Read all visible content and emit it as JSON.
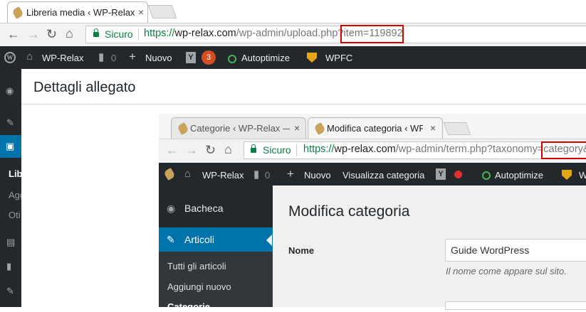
{
  "outer": {
    "tab_active": "Libreria media ‹ WP-Relax",
    "tab_close": "×",
    "address": {
      "secure_label": "Sicuro",
      "url_scheme": "https://",
      "url_host": "wp-relax.com",
      "url_path": "/wp-admin/upload.php?",
      "url_query": "item=119892"
    },
    "admin_bar": {
      "site_name": "WP-Relax",
      "comments_count": "0",
      "new_label": "Nuovo",
      "yoast_badge": "3",
      "autoptimize": "Autoptimize",
      "wpfc": "WPFC"
    },
    "page_title": "Dettagli allegato",
    "sidebar_fragments": [
      "Libr",
      "Agg",
      "Oti"
    ]
  },
  "inner": {
    "tabs": [
      {
        "label": "Categorie ‹ WP-Relax —",
        "active": false
      },
      {
        "label": "Modifica categoria ‹ WP-",
        "active": true
      }
    ],
    "tab_close": "×",
    "address": {
      "secure_label": "Sicuro",
      "url_scheme": "https://",
      "url_host": "wp-relax.com",
      "url_path": "/wp-admin/term.php?taxonomy=",
      "url_query": "category&"
    },
    "admin_bar": {
      "site_name": "WP-Relax",
      "comments_count": "0",
      "new_label": "Nuovo",
      "view_category": "Visualizza categoria",
      "autoptimize": "Autoptimize",
      "trailing": "W"
    },
    "sidebar": {
      "bacheca": "Bacheca",
      "articoli": "Articoli",
      "submenu": [
        "Tutti gli articoli",
        "Aggiungi nuovo",
        "Categorie"
      ]
    },
    "main": {
      "title": "Modifica categoria",
      "name_label": "Nome",
      "name_value": "Guide WordPress",
      "name_description": "Il nome come appare sul sito."
    }
  },
  "colors": {
    "admin_bar": "#23282d",
    "active_menu": "#0073aa",
    "secure_green": "#0b8043",
    "highlight_red": "#d40000"
  }
}
